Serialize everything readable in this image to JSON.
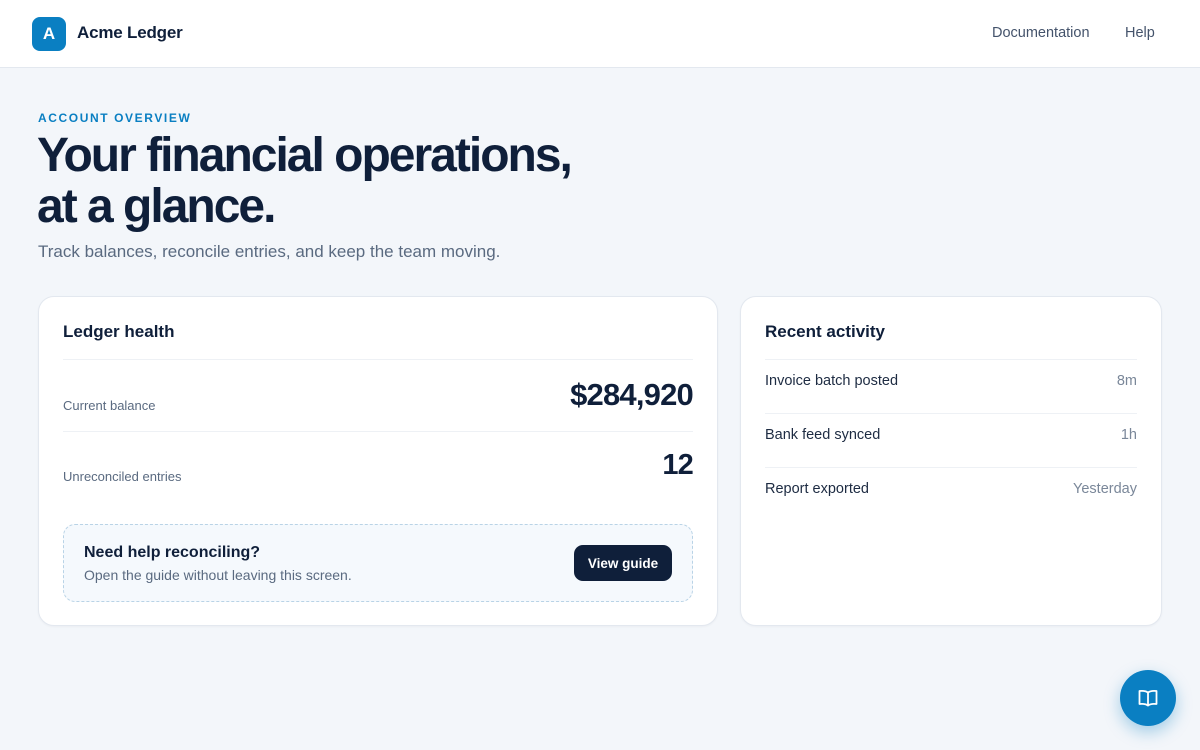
{
  "header": {
    "logo_letter": "A",
    "brand": "Acme Ledger",
    "nav": [
      "Documentation",
      "Help"
    ]
  },
  "hero": {
    "eyebrow": "ACCOUNT OVERVIEW",
    "headline_line1": "Your financial operations,",
    "headline_line2": "at a glance.",
    "subtitle": "Track balances, reconcile entries, and keep the team moving."
  },
  "health": {
    "title": "Ledger health",
    "stats": [
      {
        "label": "Current balance",
        "value": "$284,920"
      },
      {
        "label": "Unreconciled entries",
        "value": "12"
      }
    ],
    "help": {
      "title": "Need help reconciling?",
      "description": "Open the guide without leaving this screen.",
      "button": "View guide"
    }
  },
  "activity": {
    "title": "Recent activity",
    "items": [
      {
        "label": "Invoice batch posted",
        "time": "8m"
      },
      {
        "label": "Bank feed synced",
        "time": "1h"
      },
      {
        "label": "Report exported",
        "time": "Yesterday"
      }
    ]
  },
  "fab": {
    "icon": "book-open-icon"
  },
  "colors": {
    "accent": "#0a7fc2",
    "ink": "#0f1f3a",
    "background": "#f3f6fa"
  }
}
